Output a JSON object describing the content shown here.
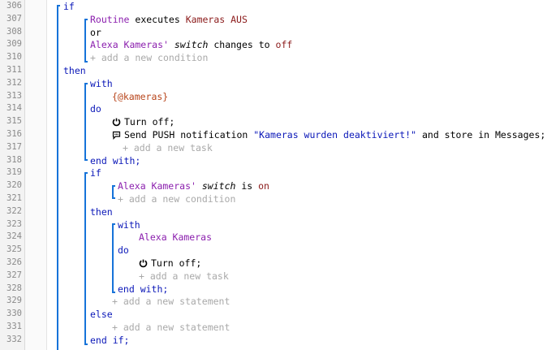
{
  "gutter": {
    "line_numbers": [
      "306",
      "307",
      "308",
      "309",
      "310",
      "311",
      "312",
      "313",
      "314",
      "315",
      "316",
      "317",
      "318",
      "319",
      "320",
      "321",
      "322",
      "323",
      "324",
      "325",
      "326",
      "327",
      "328",
      "329",
      "330",
      "331",
      "332"
    ]
  },
  "code": {
    "if": "if",
    "routine": "Routine",
    "executes": " executes ",
    "kameras_aus": "Kameras AUS",
    "or": "or",
    "alexa_kameras": "Alexa Kameras'",
    "switch": "switch",
    "changes_to": " changes to ",
    "off": "off",
    "add_condition": "+ add a new condition",
    "then": "then",
    "with": "with",
    "kameras_var": "{@kameras}",
    "do": "do",
    "turn_off": "Turn off;",
    "send_push": "Send PUSH notification ",
    "push_message": "\"Kameras wurden deaktiviert!\"",
    "store_in": " and store in Messages;",
    "add_task": "+ add a new task",
    "end_with": "end with;",
    "alexa_kameras2": "Alexa Kameras'",
    "switch2": "switch",
    "is": " is ",
    "on": "on",
    "add_condition2": "+ add a new condition",
    "then2": "then",
    "with2": "with",
    "device_alexa": "Alexa Kameras",
    "do2": "do",
    "turn_off2": "Turn off;",
    "add_task2": "+ add a new task",
    "end_with2": "end with;",
    "add_statement": "+ add a new statement",
    "else": "else",
    "add_statement2": "+ add a new statement",
    "end_if": "end if;",
    "if2": "if"
  },
  "icons": {
    "power": "power-icon",
    "chat": "chat-bubble-icon"
  },
  "colors": {
    "keyword": "#0a17b8",
    "device": "#8b1fae",
    "value": "#8b1a1a",
    "variable": "#b8451b",
    "placeholder": "#a9a9a9",
    "block_bar": "#1673d9"
  }
}
